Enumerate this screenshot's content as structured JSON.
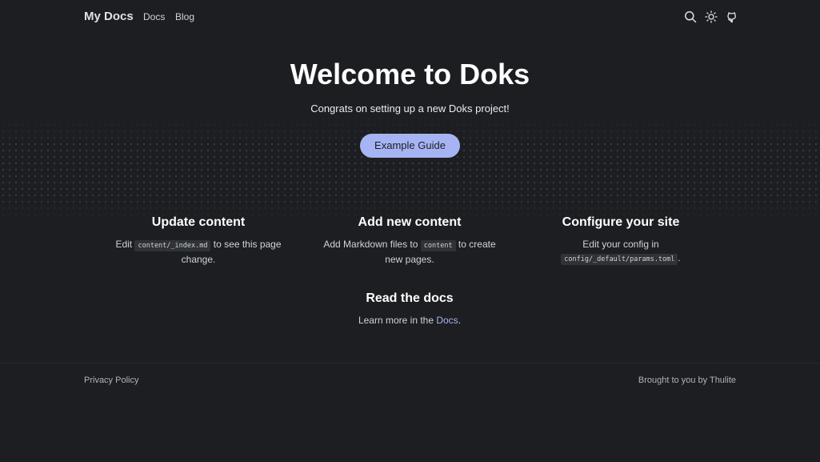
{
  "header": {
    "brand": "My Docs",
    "nav": [
      {
        "label": "Docs"
      },
      {
        "label": "Blog"
      }
    ],
    "icons": {
      "search": "search-icon",
      "theme": "sun-icon",
      "github": "github-icon"
    }
  },
  "hero": {
    "title": "Welcome to Doks",
    "lead": "Congrats on setting up a new Doks project!",
    "button_label": "Example Guide"
  },
  "features": [
    {
      "title": "Update content",
      "text_before": "Edit ",
      "code": "content/_index.md",
      "text_after": " to see this page change."
    },
    {
      "title": "Add new content",
      "text_before": "Add Markdown files to ",
      "code": "content",
      "text_after": " to create new pages."
    },
    {
      "title": "Configure your site",
      "text_before": "Edit your config in ",
      "code": "config/_default/params.toml",
      "text_after": "."
    },
    {
      "title": "Read the docs",
      "text_before": "Learn more in the ",
      "link": "Docs",
      "text_after": "."
    }
  ],
  "footer": {
    "left": "Privacy Policy",
    "right": "Brought to you by Thulite"
  },
  "colors": {
    "background": "#1d1e21",
    "accent": "#a6b4f3",
    "heading": "#ffffff",
    "text": "#ced4da",
    "code_bg": "#2f3236"
  }
}
